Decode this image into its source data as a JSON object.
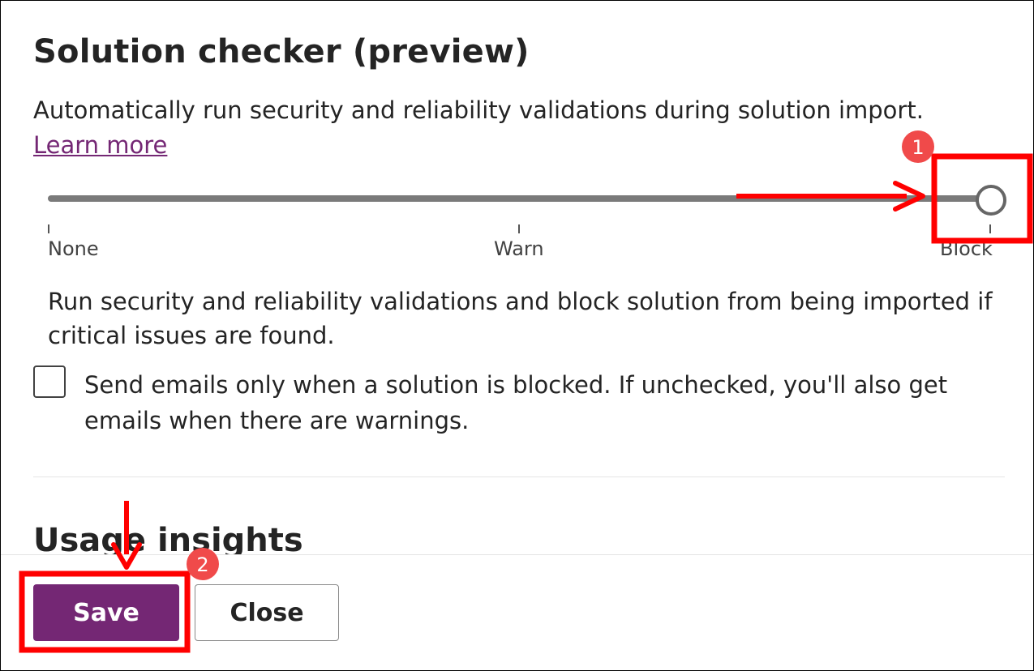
{
  "section": {
    "title": "Solution checker (preview)",
    "description": "Automatically run security and reliability validations during solution import. ",
    "learn_more_label": "Learn more"
  },
  "slider": {
    "levels": [
      {
        "label": "None"
      },
      {
        "label": "Warn"
      },
      {
        "label": "Block"
      }
    ],
    "selected": "Block",
    "selected_description": "Run security and reliability validations and block solution from being imported if critical issues are found."
  },
  "email_option": {
    "label": "Send emails only when a solution is blocked. If unchecked, you'll also get emails when there are warnings.",
    "checked": false
  },
  "next_section": {
    "title": "Usage insights"
  },
  "footer": {
    "save_label": "Save",
    "close_label": "Close"
  },
  "annotations": {
    "badges": [
      "1",
      "2"
    ],
    "color": "#ff0000",
    "badge_color": "#f04a4a"
  },
  "colors": {
    "accent": "#742774",
    "link": "#742774",
    "track": "#7a7a7a"
  }
}
